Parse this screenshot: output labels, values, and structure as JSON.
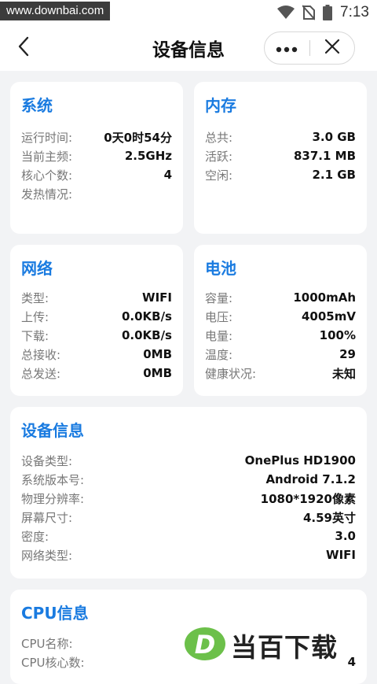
{
  "status_bar": {
    "watermark": "www.downbai.com",
    "time": "7:13",
    "icons": [
      "wifi-icon",
      "no-sim-icon",
      "battery-icon"
    ]
  },
  "nav": {
    "title": "设备信息",
    "icons": [
      "back-arrow-icon",
      "more-dots-icon",
      "close-icon"
    ]
  },
  "system": {
    "title": "系统",
    "rows": [
      {
        "label": "运行时间:",
        "value": "0天0时54分"
      },
      {
        "label": "当前主频:",
        "value": "2.5GHz"
      },
      {
        "label": "核心个数:",
        "value": "4"
      },
      {
        "label": "发热情况:",
        "value": ""
      }
    ]
  },
  "memory": {
    "title": "内存",
    "rows": [
      {
        "label": "总共:",
        "value": "3.0 GB"
      },
      {
        "label": "活跃:",
        "value": "837.1 MB"
      },
      {
        "label": "空闲:",
        "value": "2.1 GB"
      }
    ]
  },
  "network": {
    "title": "网络",
    "rows": [
      {
        "label": "类型:",
        "value": "WIFI"
      },
      {
        "label": "上传:",
        "value": "0.0KB/s"
      },
      {
        "label": "下载:",
        "value": "0.0KB/s"
      },
      {
        "label": "总接收:",
        "value": "0MB"
      },
      {
        "label": "总发送:",
        "value": "0MB"
      }
    ]
  },
  "battery": {
    "title": "电池",
    "rows": [
      {
        "label": "容量:",
        "value": "1000mAh"
      },
      {
        "label": "电压:",
        "value": "4005mV"
      },
      {
        "label": "电量:",
        "value": "100%"
      },
      {
        "label": "温度:",
        "value": "29"
      },
      {
        "label": "健康状况:",
        "value": "未知"
      }
    ]
  },
  "device": {
    "title": "设备信息",
    "rows": [
      {
        "label": "设备类型:",
        "value": "OnePlus HD1900"
      },
      {
        "label": "系统版本号:",
        "value": "Android 7.1.2"
      },
      {
        "label": "物理分辨率:",
        "value": "1080*1920像素"
      },
      {
        "label": "屏幕尺寸:",
        "value": "4.59英寸"
      },
      {
        "label": "密度:",
        "value": "3.0"
      },
      {
        "label": "网络类型:",
        "value": "WIFI"
      }
    ]
  },
  "cpu": {
    "title": "CPU信息",
    "rows": [
      {
        "label": "CPU名称:",
        "value": ""
      },
      {
        "label": "CPU核心数:",
        "value": "4"
      }
    ]
  },
  "watermark_logo": {
    "letter": "D",
    "text": "当百下载",
    "color": "#6cc04a"
  },
  "colors": {
    "accent": "#1a7be0",
    "page_bg": "#f2f3f5",
    "card_bg": "#ffffff"
  }
}
